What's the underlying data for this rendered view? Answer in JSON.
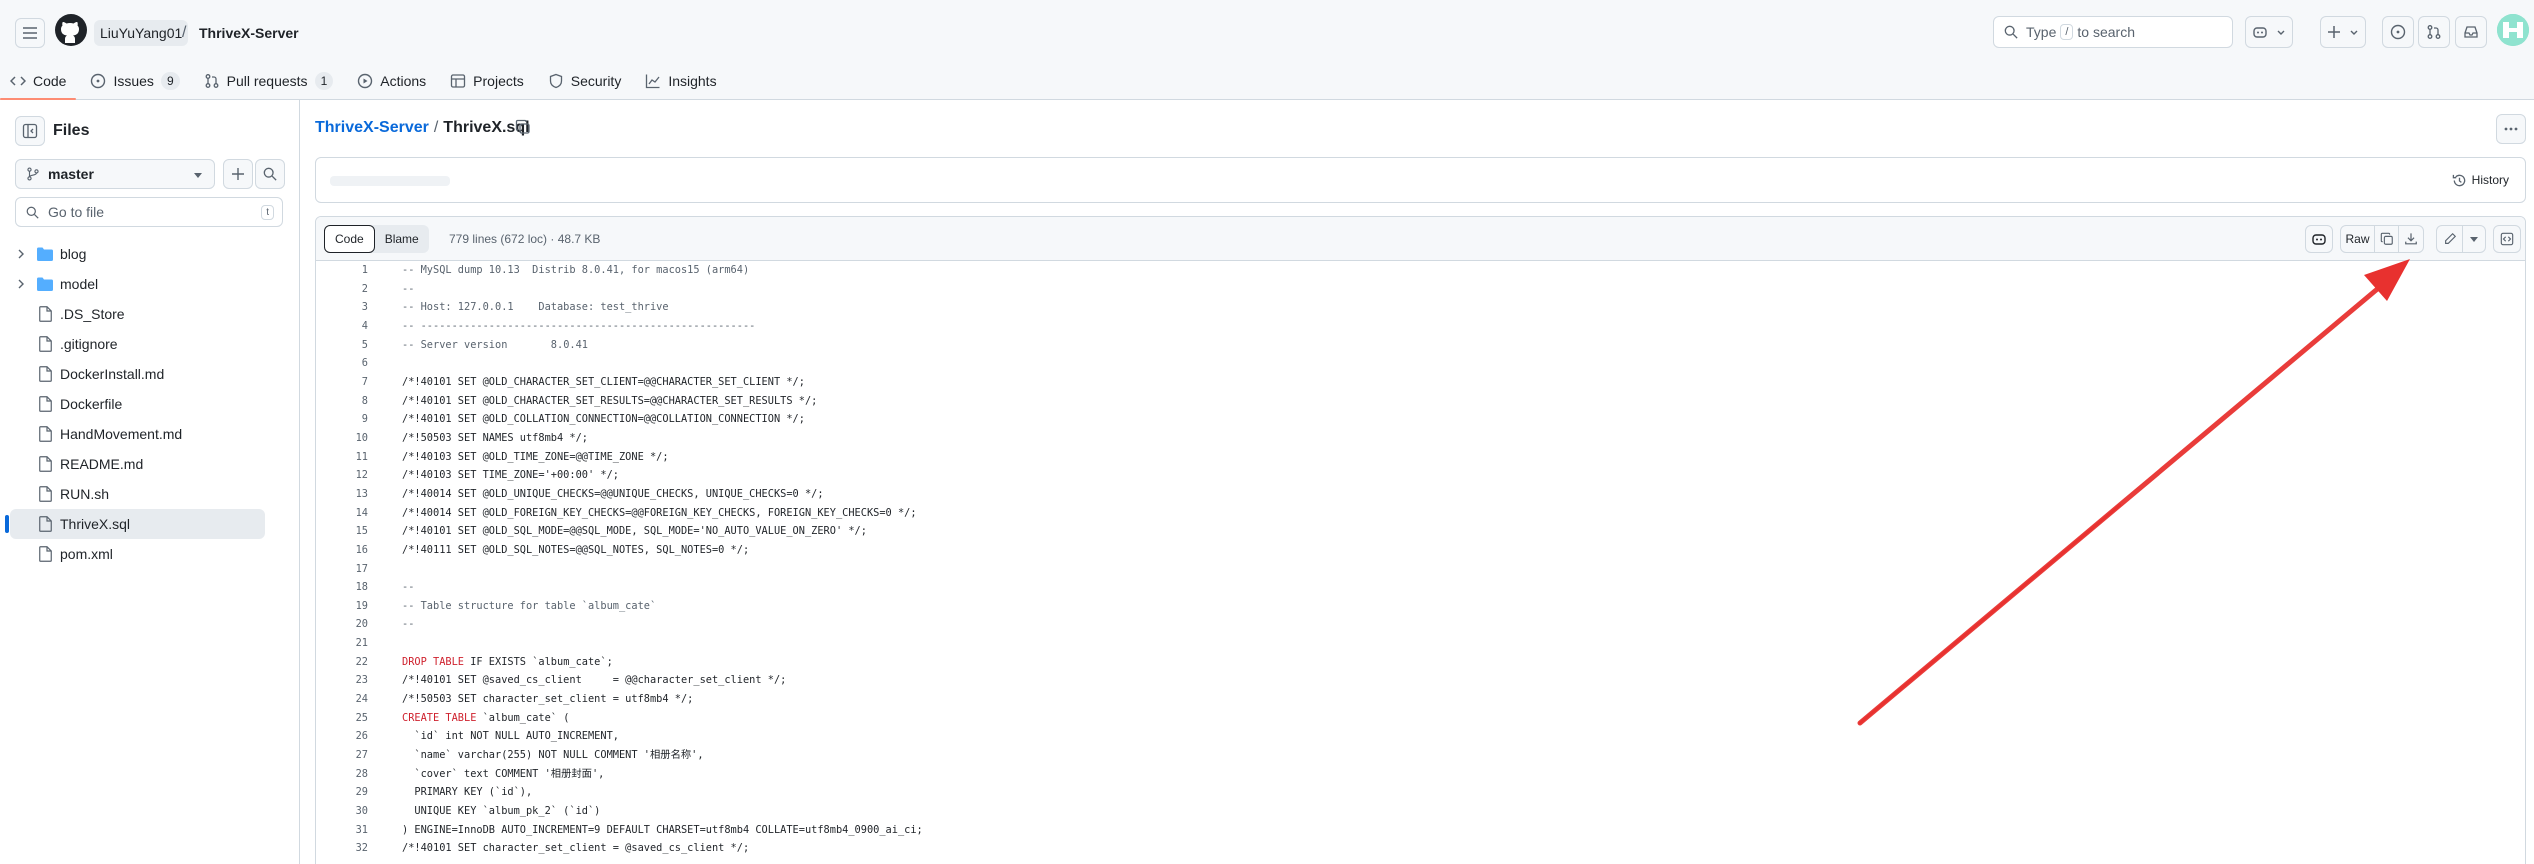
{
  "header": {
    "owner": "LiuYuYang01",
    "separator": "/",
    "repo": "ThriveX-Server",
    "search": {
      "prefix": "Type",
      "key": "/",
      "suffix": "to search"
    }
  },
  "repo_nav": {
    "code": "Code",
    "issues": "Issues",
    "issues_count": "9",
    "pull_requests": "Pull requests",
    "pull_requests_count": "1",
    "actions": "Actions",
    "projects": "Projects",
    "security": "Security",
    "insights": "Insights"
  },
  "sidebar": {
    "title": "Files",
    "branch": "master",
    "goto_placeholder": "Go to file",
    "goto_key": "t",
    "items": [
      {
        "label": "blog",
        "type": "folder"
      },
      {
        "label": "model",
        "type": "folder"
      },
      {
        "label": ".DS_Store",
        "type": "file"
      },
      {
        "label": ".gitignore",
        "type": "file"
      },
      {
        "label": "DockerInstall.md",
        "type": "file"
      },
      {
        "label": "Dockerfile",
        "type": "file"
      },
      {
        "label": "HandMovement.md",
        "type": "file"
      },
      {
        "label": "README.md",
        "type": "file"
      },
      {
        "label": "RUN.sh",
        "type": "file"
      },
      {
        "label": "ThriveX.sql",
        "type": "file",
        "selected": true
      },
      {
        "label": "pom.xml",
        "type": "file"
      }
    ]
  },
  "main": {
    "breadcrumb_repo": "ThriveX-Server",
    "breadcrumb_sep": "/",
    "breadcrumb_file": "ThriveX.sql",
    "history_label": "History",
    "tab_code": "Code",
    "tab_blame": "Blame",
    "file_meta": "779 lines (672 loc) · 48.7 KB",
    "raw_label": "Raw"
  },
  "code_lines": [
    {
      "n": "1",
      "t": "-- MySQL dump 10.13  Distrib 8.0.41, for macos15 (arm64)",
      "k": "comment"
    },
    {
      "n": "2",
      "t": "--",
      "k": "comment"
    },
    {
      "n": "3",
      "t": "-- Host: 127.0.0.1    Database: test_thrive",
      "k": "comment"
    },
    {
      "n": "4",
      "t": "-- ------------------------------------------------------",
      "k": "comment"
    },
    {
      "n": "5",
      "t": "-- Server version\t8.0.41",
      "k": "comment"
    },
    {
      "n": "6",
      "t": "",
      "k": "plain"
    },
    {
      "n": "7",
      "t": "/*!40101 SET @OLD_CHARACTER_SET_CLIENT=@@CHARACTER_SET_CLIENT */;",
      "k": "plain"
    },
    {
      "n": "8",
      "t": "/*!40101 SET @OLD_CHARACTER_SET_RESULTS=@@CHARACTER_SET_RESULTS */;",
      "k": "plain"
    },
    {
      "n": "9",
      "t": "/*!40101 SET @OLD_COLLATION_CONNECTION=@@COLLATION_CONNECTION */;",
      "k": "plain"
    },
    {
      "n": "10",
      "t": "/*!50503 SET NAMES utf8mb4 */;",
      "k": "plain"
    },
    {
      "n": "11",
      "t": "/*!40103 SET @OLD_TIME_ZONE=@@TIME_ZONE */;",
      "k": "plain"
    },
    {
      "n": "12",
      "t": "/*!40103 SET TIME_ZONE='+00:00' */;",
      "k": "plain"
    },
    {
      "n": "13",
      "t": "/*!40014 SET @OLD_UNIQUE_CHECKS=@@UNIQUE_CHECKS, UNIQUE_CHECKS=0 */;",
      "k": "plain"
    },
    {
      "n": "14",
      "t": "/*!40014 SET @OLD_FOREIGN_KEY_CHECKS=@@FOREIGN_KEY_CHECKS, FOREIGN_KEY_CHECKS=0 */;",
      "k": "plain"
    },
    {
      "n": "15",
      "t": "/*!40101 SET @OLD_SQL_MODE=@@SQL_MODE, SQL_MODE='NO_AUTO_VALUE_ON_ZERO' */;",
      "k": "plain"
    },
    {
      "n": "16",
      "t": "/*!40111 SET @OLD_SQL_NOTES=@@SQL_NOTES, SQL_NOTES=0 */;",
      "k": "plain"
    },
    {
      "n": "17",
      "t": "",
      "k": "plain"
    },
    {
      "n": "18",
      "t": "--",
      "k": "comment"
    },
    {
      "n": "19",
      "t": "-- Table structure for table `album_cate`",
      "k": "comment"
    },
    {
      "n": "20",
      "t": "--",
      "k": "comment"
    },
    {
      "n": "21",
      "t": "",
      "k": "plain"
    },
    {
      "n": "22",
      "t": "DROP TABLE IF EXISTS `album_cate`;",
      "k": "kw",
      "kwlen": 10
    },
    {
      "n": "23",
      "t": "/*!40101 SET @saved_cs_client     = @@character_set_client */;",
      "k": "plain"
    },
    {
      "n": "24",
      "t": "/*!50503 SET character_set_client = utf8mb4 */;",
      "k": "plain"
    },
    {
      "n": "25",
      "t": "CREATE TABLE `album_cate` (",
      "k": "kw",
      "kwlen": 12
    },
    {
      "n": "26",
      "t": "  `id` int NOT NULL AUTO_INCREMENT,",
      "k": "plain"
    },
    {
      "n": "27",
      "t": "  `name` varchar(255) NOT NULL COMMENT '相册名称',",
      "k": "plain"
    },
    {
      "n": "28",
      "t": "  `cover` text COMMENT '相册封面',",
      "k": "plain"
    },
    {
      "n": "29",
      "t": "  PRIMARY KEY (`id`),",
      "k": "plain"
    },
    {
      "n": "30",
      "t": "  UNIQUE KEY `album_pk_2` (`id`)",
      "k": "plain"
    },
    {
      "n": "31",
      "t": ") ENGINE=InnoDB AUTO_INCREMENT=9 DEFAULT CHARSET=utf8mb4 COLLATE=utf8mb4_0900_ai_ci;",
      "k": "plain"
    },
    {
      "n": "32",
      "t": "/*!40101 SET character_set_client = @saved_cs_client */;",
      "k": "plain"
    }
  ],
  "colors": {
    "accent": "#0969da",
    "annotation_arrow": "#e8312f",
    "active_tab_underline": "#fd8c73"
  }
}
